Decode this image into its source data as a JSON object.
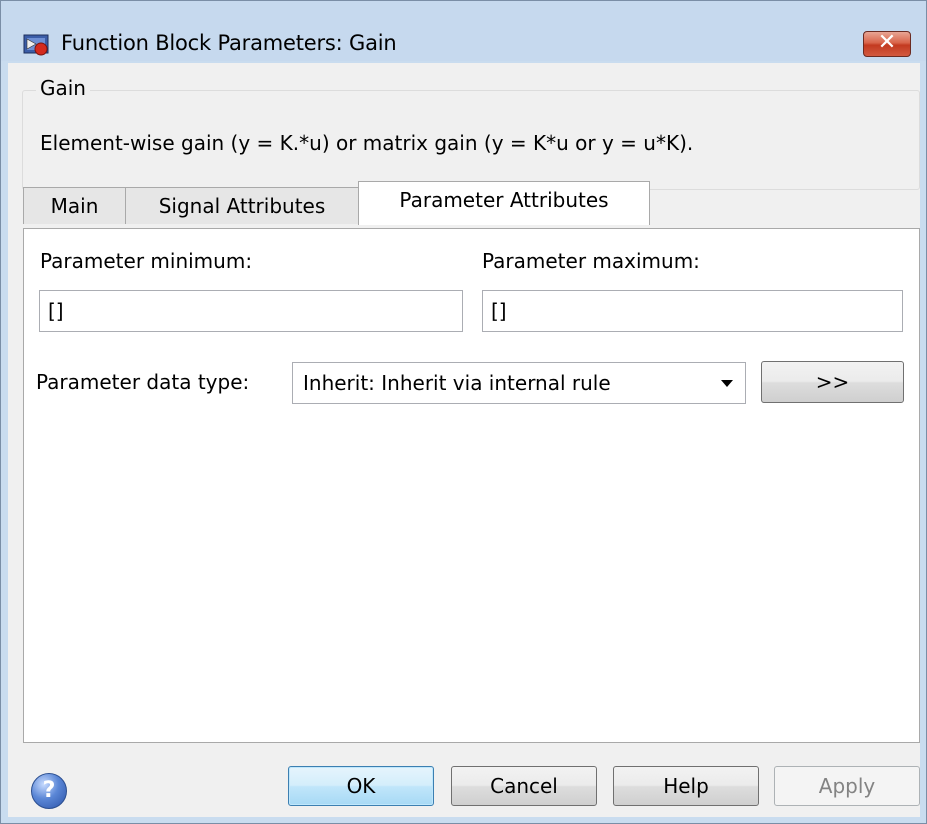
{
  "window": {
    "title": "Function Block Parameters: Gain",
    "close_symbol": "✕"
  },
  "gain_group": {
    "legend": "Gain",
    "description": "Element-wise gain (y = K.*u) or matrix gain (y = K*u or y = u*K)."
  },
  "tabs": [
    {
      "label": "Main",
      "active": false
    },
    {
      "label": "Signal Attributes",
      "active": false
    },
    {
      "label": "Parameter Attributes",
      "active": true
    }
  ],
  "parameter_attributes": {
    "min_label": "Parameter minimum:",
    "min_value": "[]",
    "max_label": "Parameter maximum:",
    "max_value": "[]",
    "data_type_label": "Parameter data type:",
    "data_type_value": "Inherit: Inherit via internal rule",
    "assistant_button": ">>"
  },
  "buttons": {
    "ok": "OK",
    "cancel": "Cancel",
    "help": "Help",
    "apply": "Apply"
  },
  "help_icon_glyph": "?",
  "icons": {
    "title": "simulink-block-icon",
    "help": "help-icon"
  }
}
